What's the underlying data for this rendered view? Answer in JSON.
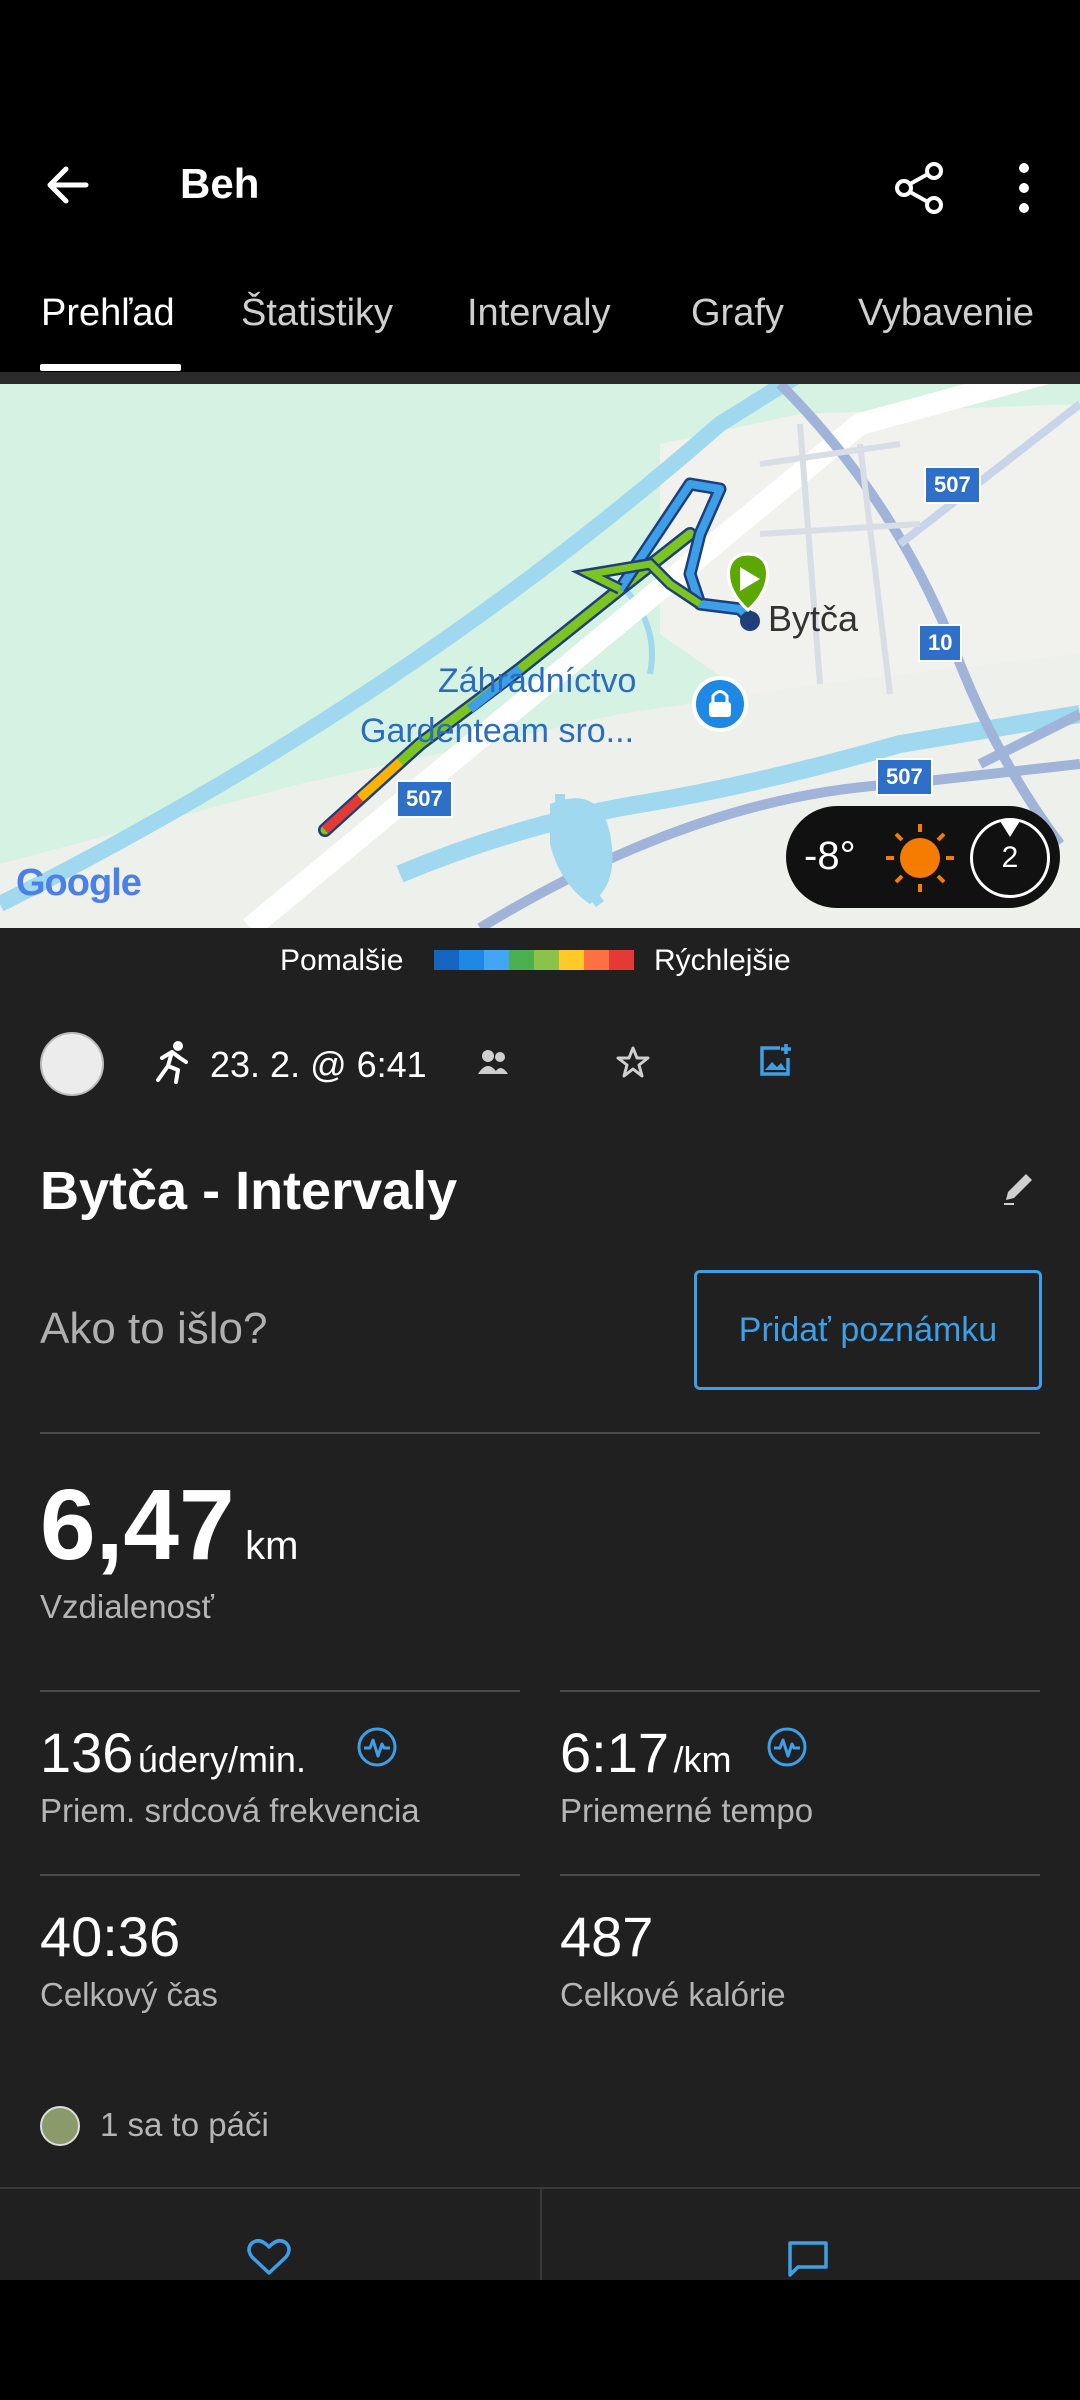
{
  "header": {
    "title": "Beh"
  },
  "tabs": [
    {
      "label": "Prehľad"
    },
    {
      "label": "Štatistiky"
    },
    {
      "label": "Intervaly"
    },
    {
      "label": "Grafy"
    },
    {
      "label": "Vybavenie"
    }
  ],
  "map": {
    "place_labels": {
      "town": "Bytča",
      "poi_line1": "Záhradníctvo",
      "poi_line2": "Gardenteam sro...",
      "road_507": "507",
      "road_10": "10"
    },
    "google_logo": "Google",
    "weather": {
      "temperature": "-8°",
      "wind": "2"
    }
  },
  "legend": {
    "slower": "Pomalšie",
    "faster": "Rýchlejšie"
  },
  "meta": {
    "datetime": "23. 2. @ 6:41"
  },
  "activity": {
    "title": "Bytča - Intervaly",
    "prompt": "Ako to išlo?",
    "add_note": "Pridať poznámku"
  },
  "stats": {
    "distance": {
      "value": "6,47",
      "unit": "km",
      "label": "Vzdialenosť"
    },
    "heart_rate": {
      "value": "136",
      "unit": "údery/min.",
      "label": "Priem. srdcová frekvencia"
    },
    "pace": {
      "value": "6:17",
      "unit": "/km",
      "label": "Priemerné tempo"
    },
    "time": {
      "value": "40:36",
      "label": "Celkový čas"
    },
    "calories": {
      "value": "487",
      "label": "Celkové kalórie"
    }
  },
  "likes": {
    "text": "1 sa to páči"
  },
  "colors": {
    "accent": "#3d9fe8",
    "route_fast": "#e53935",
    "route_slow": "#1565c0",
    "route_mid": "#7cc520"
  }
}
